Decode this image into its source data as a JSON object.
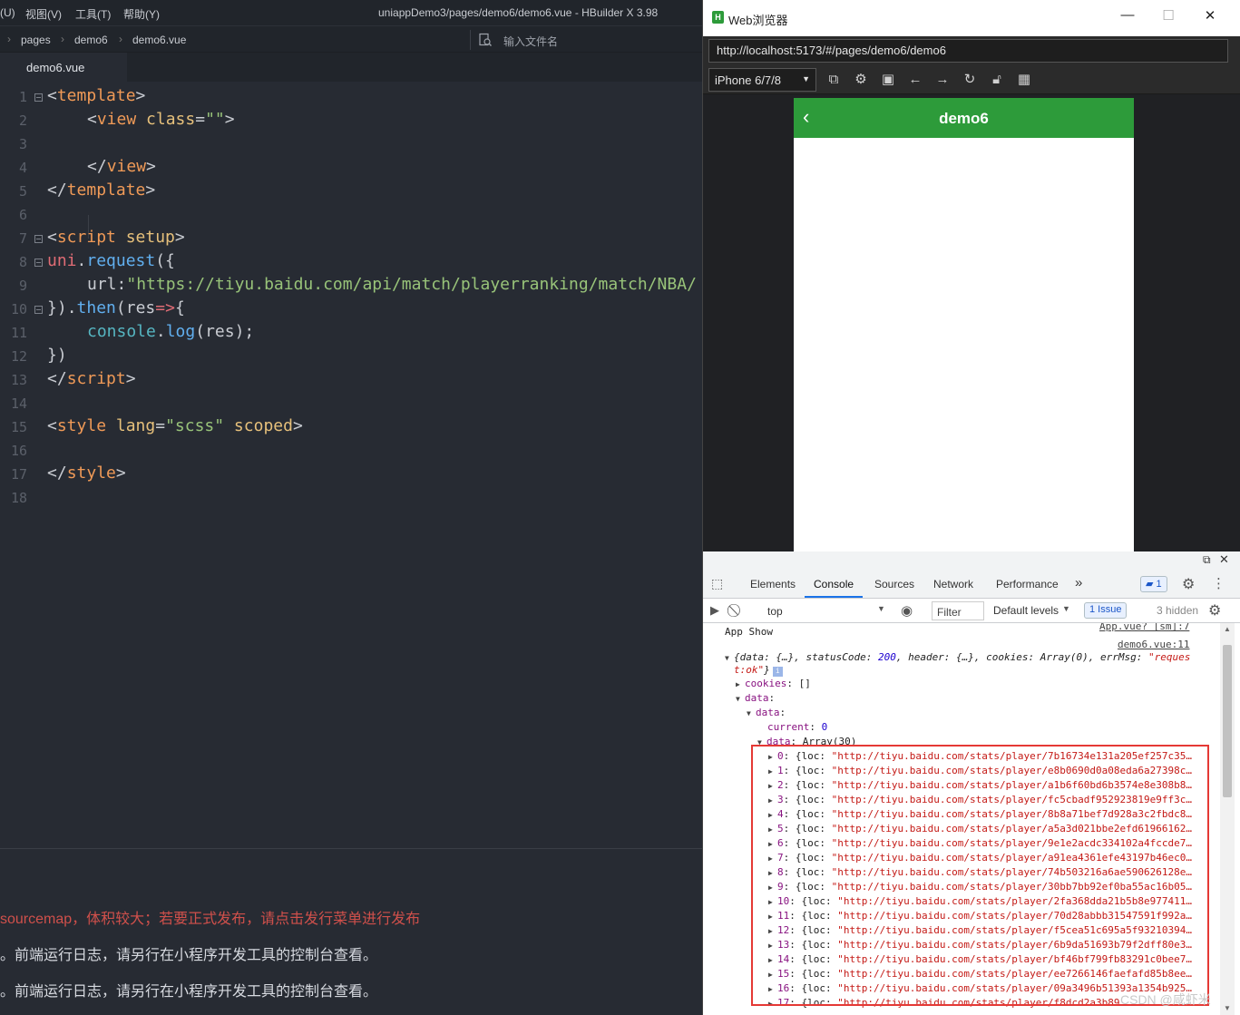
{
  "ide": {
    "menus": [
      "(U)",
      "视图(V)",
      "工具(T)",
      "帮助(Y)"
    ],
    "window_title": "uniappDemo3/pages/demo6/demo6.vue - HBuilder X 3.98",
    "breadcrumb": [
      "pages",
      "demo6",
      "demo6.vue"
    ],
    "file_search_placeholder": "输入文件名",
    "active_tab": "demo6.vue",
    "line_numbers": [
      "1",
      "2",
      "3",
      "4",
      "5",
      "6",
      "7",
      "8",
      "9",
      "10",
      "11",
      "12",
      "13",
      "14",
      "15",
      "16",
      "17",
      "18"
    ],
    "code": {
      "l1": [
        "<",
        "template",
        ">"
      ],
      "l2": [
        "<",
        "view",
        " class",
        "=",
        "\"\"",
        ">"
      ],
      "l4": [
        "</",
        "view",
        ">"
      ],
      "l5": [
        "</",
        "template",
        ">"
      ],
      "l7": [
        "<",
        "script",
        " setup",
        ">"
      ],
      "l8": [
        "uni",
        ".",
        "request",
        "({"
      ],
      "l9": [
        "url",
        ":",
        "\"https://tiyu.baidu.com/api/match/playerranking/match/NBA/"
      ],
      "l10": [
        "})",
        ".",
        "then",
        "(",
        "res",
        "=>",
        "{"
      ],
      "l11": [
        "console",
        ".",
        "log",
        "(",
        "res",
        ");"
      ],
      "l12": [
        "})"
      ],
      "l13": [
        "</",
        "script",
        ">"
      ],
      "l15": [
        "<",
        "style",
        " lang",
        "=",
        "\"scss\"",
        " scoped",
        ">"
      ],
      "l17": [
        "</",
        "style",
        ">"
      ]
    },
    "console_logs": [
      {
        "text": "sourcemap，体积较大；若要正式发布，请点击发行菜单进行发布",
        "color": "#d0504b"
      },
      {
        "text": "。前端运行日志，请另行在小程序开发工具的控制台查看。",
        "color": "#d7dae0"
      },
      {
        "text": "。前端运行日志，请另行在小程序开发工具的控制台查看。",
        "color": "#d7dae0"
      }
    ]
  },
  "browser": {
    "title": "Web浏览器",
    "logo_letter": "H",
    "window_controls": [
      "—",
      "☐",
      "✕"
    ],
    "url": "http://localhost:5173/#/pages/demo6/demo6",
    "device": "iPhone 6/7/8",
    "page_title": "demo6",
    "back_glyph": "‹"
  },
  "devtools": {
    "tabs": [
      "Elements",
      "Console",
      "Sources",
      "Network",
      "Performance"
    ],
    "more_tabs": "»",
    "messages_badge": "1",
    "context": "top",
    "filter_placeholder": "Filter",
    "levels": "Default levels",
    "issues_badge": "1 Issue",
    "hidden": "3 hidden",
    "output": {
      "app_show": "App  Show",
      "app_show_src": "App.vue? [sm]:7",
      "res_src": "demo6.vue:11",
      "res_summary_1": "{data: {…}, statusCode: ",
      "status_code": "200",
      "res_summary_2": ", header: {…}, cookies: Array(0), errMsg: ",
      "errmsg_1": "\"reques",
      "errmsg_2": "t:ok\"",
      "res_summary_3": "}",
      "cookies_key": "cookies",
      "cookies_val": ": []",
      "data_key": "data",
      "data_inner_key": "data",
      "current_key": "current",
      "current_val": "0",
      "array_key": "data",
      "array_val": ": Array(30)",
      "items": [
        {
          "i": "0",
          "hash": "7b16734e131a205ef257c35…"
        },
        {
          "i": "1",
          "hash": "e8b0690d0a08eda6a27398c…"
        },
        {
          "i": "2",
          "hash": "a1b6f60bd6b3574e8e308b8…"
        },
        {
          "i": "3",
          "hash": "fc5cbadf952923819e9ff3c…"
        },
        {
          "i": "4",
          "hash": "8b8a71bef7d928a3c2fbdc8…"
        },
        {
          "i": "5",
          "hash": "a5a3d021bbe2efd61966162…"
        },
        {
          "i": "6",
          "hash": "9e1e2acdc334102a4fccde7…"
        },
        {
          "i": "7",
          "hash": "a91ea4361efe43197b46ec0…"
        },
        {
          "i": "8",
          "hash": "74b503216a6ae590626128e…"
        },
        {
          "i": "9",
          "hash": "30bb7bb92ef0ba55ac16b05…"
        },
        {
          "i": "10",
          "hash": "2fa368dda21b5b8e977411…"
        },
        {
          "i": "11",
          "hash": "70d28abbb31547591f992a…"
        },
        {
          "i": "12",
          "hash": "f5cea51c695a5f93210394…"
        },
        {
          "i": "13",
          "hash": "6b9da51693b79f2dff80e3…"
        },
        {
          "i": "14",
          "hash": "bf46bf799fb83291c0bee7…"
        },
        {
          "i": "15",
          "hash": "ee7266146faefafd85b8ee…"
        },
        {
          "i": "16",
          "hash": "09a3496b51393a1354b925…"
        },
        {
          "i": "17",
          "hash": "f8dcd2a3b89…"
        }
      ],
      "loc_prefix": "{loc: ",
      "url_prefix": "\"http://tiyu.baidu.com/stats/player/"
    },
    "watermark": "CSDN @咸虾米"
  }
}
